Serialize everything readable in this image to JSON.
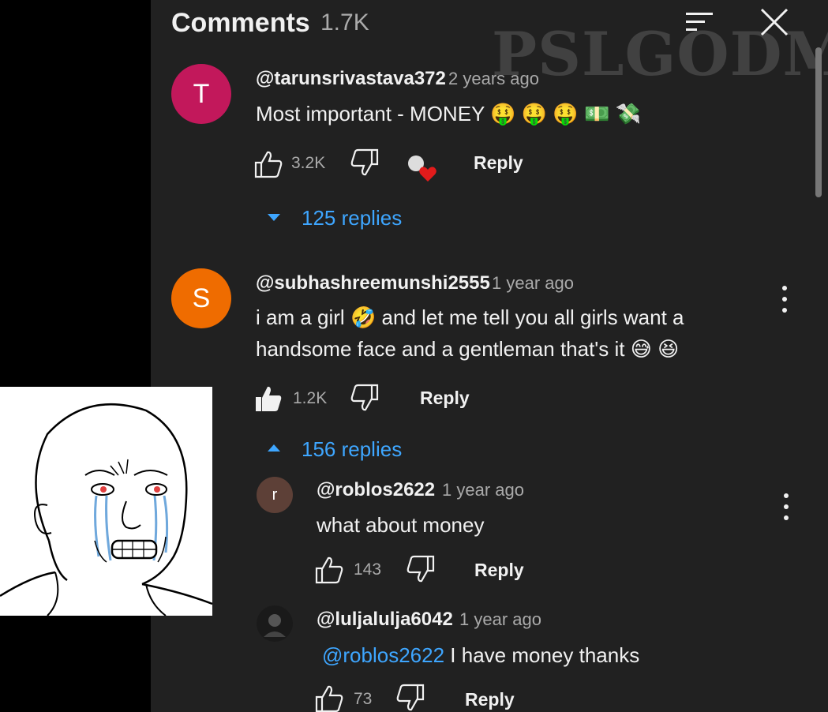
{
  "header": {
    "title": "Comments",
    "count": "1.7K"
  },
  "watermark": "PSLGODMF",
  "comments": [
    {
      "initial": "T",
      "avatar_color": "#c2185b",
      "handle": "@tarunsrivastava372",
      "time": "2 years ago",
      "text": "Most important - MONEY",
      "emoji": "🤑 🤑 🤑 💵 💸",
      "likes": "3.2K",
      "reply_label": "Reply",
      "replies_toggle": "125 replies"
    },
    {
      "initial": "S",
      "avatar_color": "#ef6c00",
      "handle": "@subhashreemunshi2555",
      "time": "1 year ago",
      "line1_a": "i am a girl",
      "line1_emoji": "🤣",
      "line1_b": "and let me tell you all girls want a",
      "line2": "handsome face and a gentleman that's it",
      "line2_emoji": "😅 😆",
      "likes": "1.2K",
      "reply_label": "Reply",
      "replies_toggle": "156 replies"
    }
  ],
  "replies": [
    {
      "initial": "r",
      "avatar_color": "#5d4037",
      "handle": "@roblos2622",
      "time": "1 year ago",
      "text": "what about money",
      "likes": "143",
      "reply_label": "Reply"
    },
    {
      "handle": "@luljalulja6042",
      "time": "1 year ago",
      "mention": "@roblos2622",
      "text": "I have money thanks",
      "likes": "73",
      "reply_label": "Reply"
    }
  ]
}
